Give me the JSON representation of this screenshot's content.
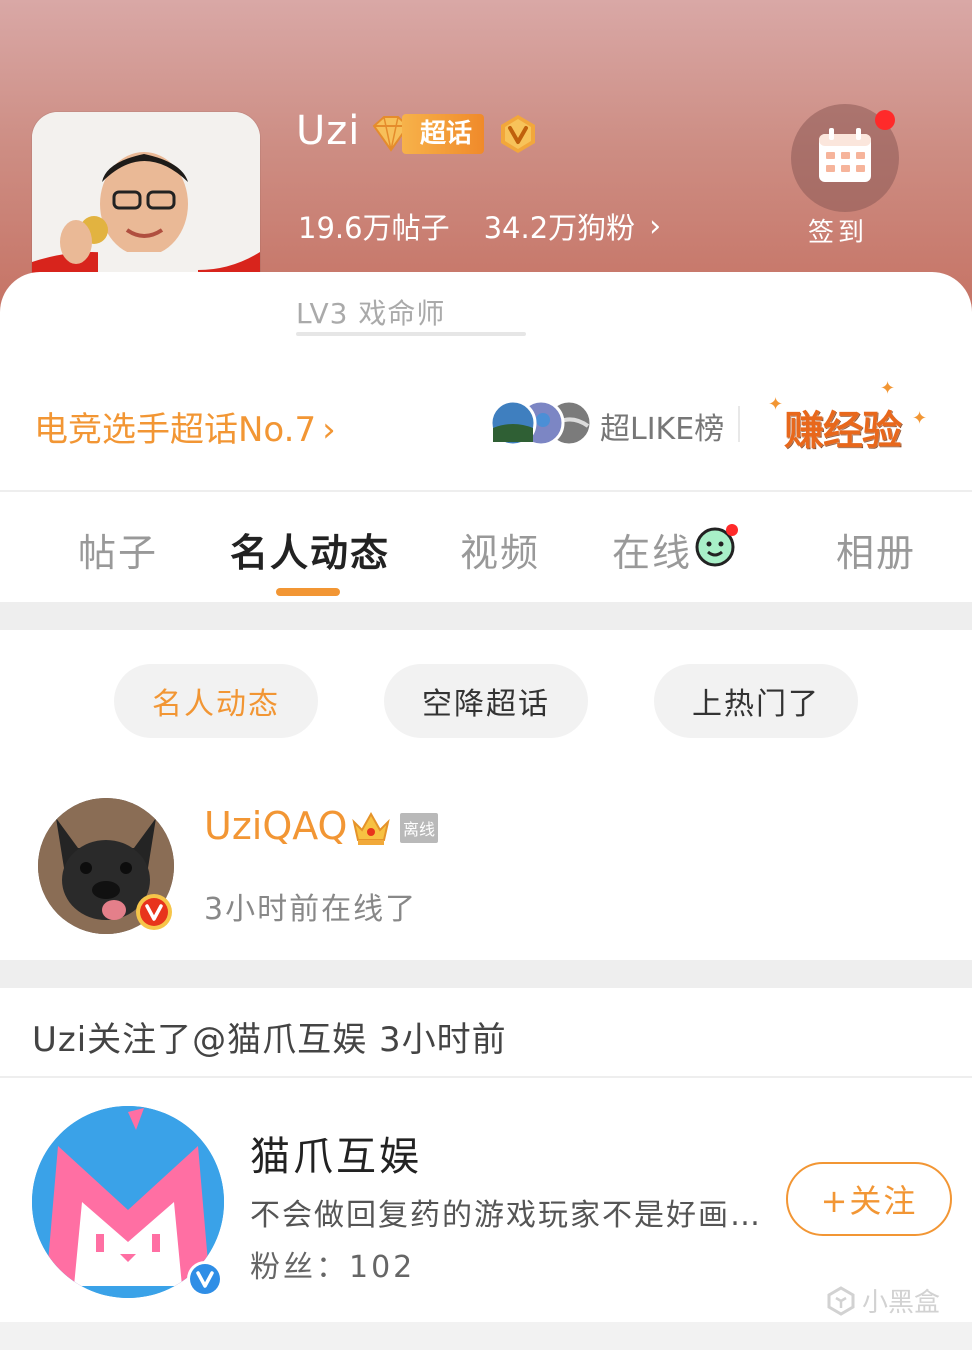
{
  "header": {
    "title": "Uzi",
    "chaohua_badge": "超话",
    "stats": {
      "posts": "19.6万帖子",
      "fans": "34.2万狗粉",
      "chevron": "›"
    },
    "signin_label": "签到",
    "level": "LV3 戏命师"
  },
  "rank_bar": {
    "rank_text": "电竞选手超话No.7",
    "rank_chevron": "›",
    "like_label": "超LIKE榜",
    "earn_label": "赚经验"
  },
  "tabs": [
    {
      "label": "帖子",
      "active": false
    },
    {
      "label": "名人动态",
      "active": true
    },
    {
      "label": "视频",
      "active": false
    },
    {
      "label": "在线",
      "active": false
    },
    {
      "label": "相册",
      "active": false
    }
  ],
  "chips": [
    {
      "label": "名人动态",
      "active": true
    },
    {
      "label": "空降超话",
      "active": false
    },
    {
      "label": "上热门了",
      "active": false
    }
  ],
  "celebrity": {
    "name": "UziQAQ",
    "status_badge": "离线",
    "online_text": "3小时前在线了"
  },
  "feed": {
    "title": "Uzi关注了@猫爪互娱 3小时前",
    "account": {
      "name": "猫爪互娱",
      "description": "不会做回复药的游戏玩家不是好画…",
      "fans": "粉丝：102",
      "follow_label": "+关注"
    }
  },
  "watermark": "小黑盒",
  "colors": {
    "accent": "#f29634",
    "hero": "#cd8d83",
    "vip_red": "#e8341c",
    "verify_blue": "#2f8ee6"
  }
}
